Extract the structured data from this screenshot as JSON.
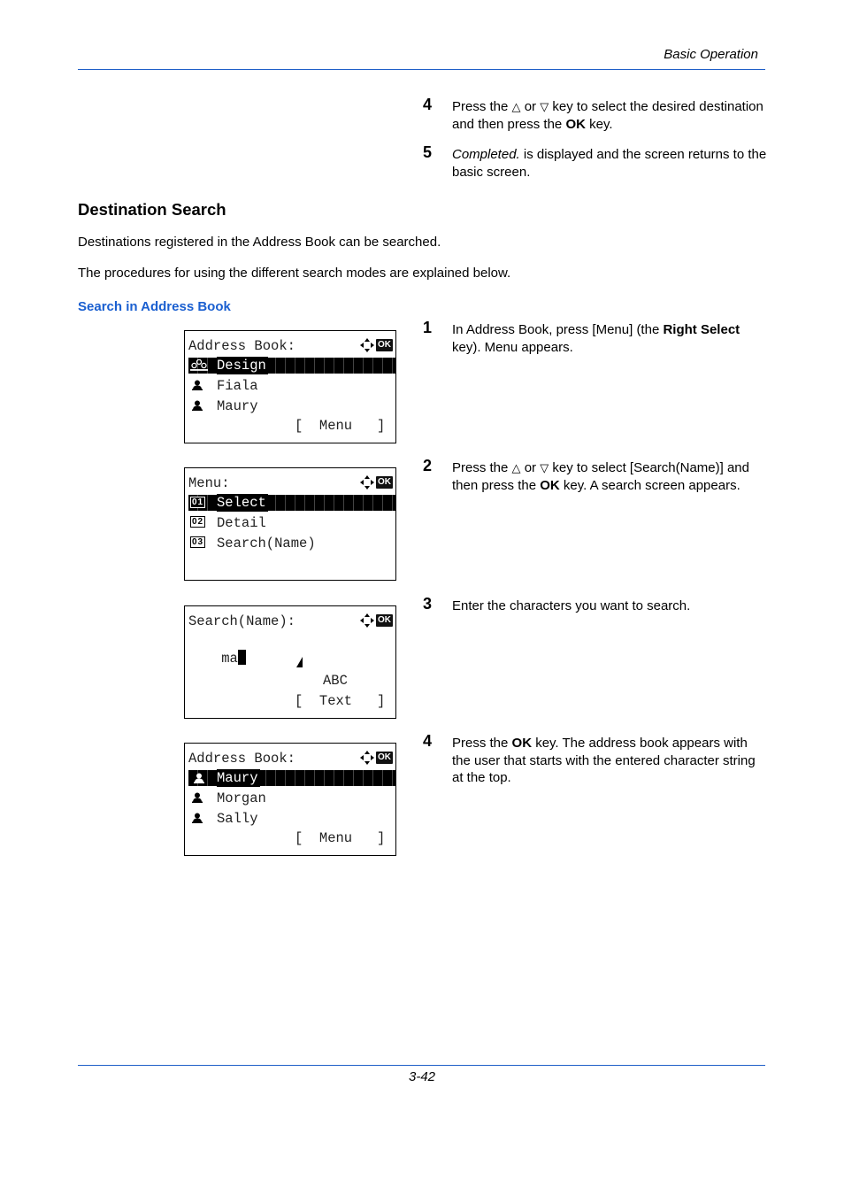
{
  "header": {
    "section": "Basic Operation"
  },
  "footer": {
    "page_number": "3-42"
  },
  "top_steps": [
    {
      "num": "4",
      "parts": [
        "Press the ",
        "△",
        " or ",
        "▽",
        " key to select the desired destination and then press the ",
        "OK",
        " key."
      ]
    },
    {
      "num": "5",
      "italic": "Completed.",
      "rest": " is displayed and the screen returns to the basic screen."
    }
  ],
  "section": {
    "title": "Destination Search",
    "paragraphs": [
      "Destinations registered in the Address Book can be searched.",
      "The procedures for using the different search modes are explained below."
    ],
    "subsection_title": "Search in Address Book"
  },
  "steps": [
    {
      "num": "1",
      "pre": "In Address Book, press [Menu] (the ",
      "bold": "Right Select",
      "post": " key). Menu appears."
    },
    {
      "num": "2",
      "pre": "Press the ",
      "up": "△",
      "mid": " or ",
      "down": "▽",
      "mid2": " key to select [Search(Name)] and then press the ",
      "bold": "OK",
      "post": " key. A search screen appears."
    },
    {
      "num": "3",
      "text": "Enter the characters you want to search."
    },
    {
      "num": "4",
      "pre": "Press the ",
      "bold": "OK",
      "post": " key. The address book appears with the user that starts with the entered character string at the top."
    }
  ],
  "screens": [
    {
      "title": "Address Book:",
      "ok_label": "OK",
      "selected": {
        "icon": "group-icon",
        "label": "Design"
      },
      "rows": [
        {
          "icon": "person-icon",
          "label": "Fiala"
        },
        {
          "icon": "person-icon",
          "label": "Maury"
        }
      ],
      "softkey": "[  Menu   ]"
    },
    {
      "title": "Menu:",
      "ok_label": "OK",
      "selected": {
        "number": "01",
        "label": "Select"
      },
      "rows": [
        {
          "number": "02",
          "label": "Detail"
        },
        {
          "number": "03",
          "label": "Search(Name)"
        }
      ]
    },
    {
      "title": "Search(Name):",
      "ok_label": "OK",
      "input_value": "ma",
      "input_mode": "ABC",
      "softkey": "[  Text   ]"
    },
    {
      "title": "Address Book:",
      "ok_label": "OK",
      "selected": {
        "icon": "person-icon",
        "label": "Maury"
      },
      "rows": [
        {
          "icon": "person-icon",
          "label": "Morgan"
        },
        {
          "icon": "person-icon",
          "label": "Sally"
        }
      ],
      "softkey": "[  Menu   ]"
    }
  ]
}
